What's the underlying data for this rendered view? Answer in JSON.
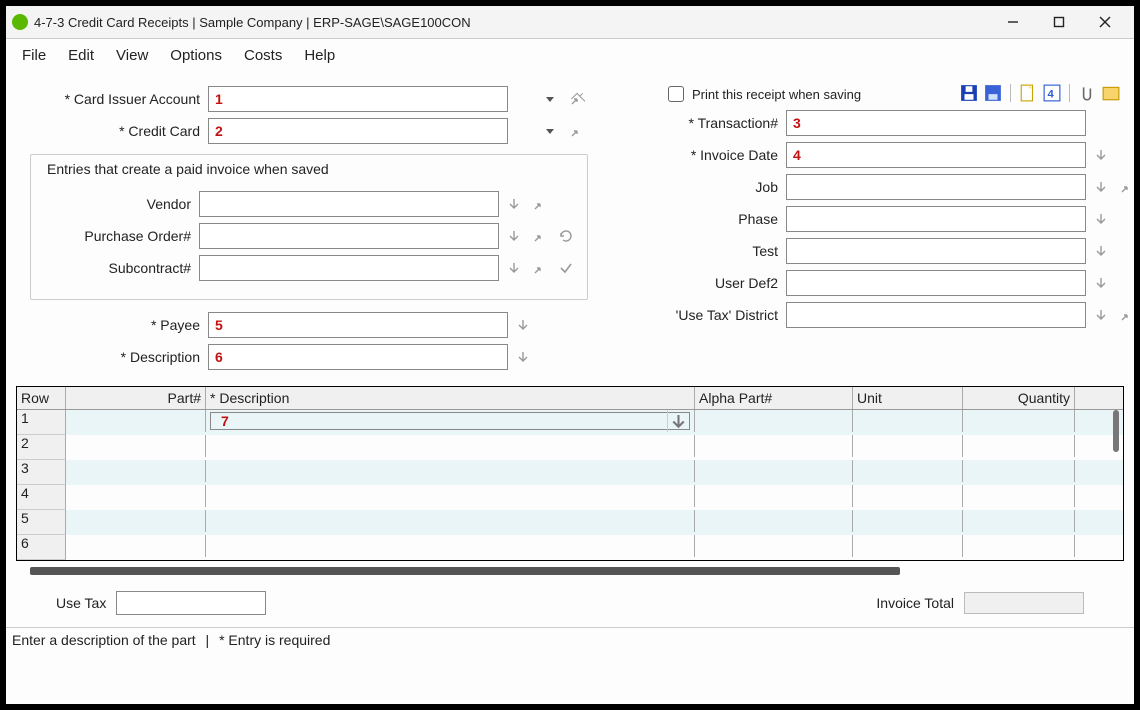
{
  "window": {
    "title": "4-7-3 Credit Card Receipts  |  Sample Company  |  ERP-SAGE\\SAGE100CON"
  },
  "menu": {
    "file": "File",
    "edit": "Edit",
    "view": "View",
    "options": "Options",
    "costs": "Costs",
    "help": "Help"
  },
  "left": {
    "card_issuer_label": "* Card Issuer Account",
    "card_issuer_value": "1",
    "credit_card_label": "* Credit Card",
    "credit_card_value": "2",
    "fieldset_legend": "Entries that create a paid invoice when saved",
    "vendor_label": "Vendor",
    "vendor_value": "",
    "po_label": "Purchase Order#",
    "po_value": "",
    "subcontract_label": "Subcontract#",
    "subcontract_value": "",
    "payee_label": "* Payee",
    "payee_value": "5",
    "description_label": "* Description",
    "description_value": "6"
  },
  "right": {
    "print_label": "Print this receipt when saving",
    "transaction_label": "* Transaction#",
    "transaction_value": "3",
    "invoice_date_label": "* Invoice Date",
    "invoice_date_value": "4",
    "job_label": "Job",
    "job_value": "",
    "phase_label": "Phase",
    "phase_value": "",
    "test_label": "Test",
    "test_value": "",
    "userdef2_label": "User Def2",
    "userdef2_value": "",
    "usetaxdist_label": "'Use Tax' District",
    "usetaxdist_value": ""
  },
  "grid": {
    "headers": {
      "row": "Row",
      "part": "Part#",
      "desc": "* Description",
      "alpha": "Alpha Part#",
      "unit": "Unit",
      "qty": "Quantity"
    },
    "rows": [
      "1",
      "2",
      "3",
      "4",
      "5",
      "6"
    ],
    "row1_desc_value": "7"
  },
  "footer": {
    "use_tax_label": "Use Tax",
    "use_tax_value": "",
    "invoice_total_label": "Invoice Total",
    "invoice_total_value": ""
  },
  "status": {
    "msg": "Enter a description of the part",
    "req": "*  Entry is required"
  }
}
